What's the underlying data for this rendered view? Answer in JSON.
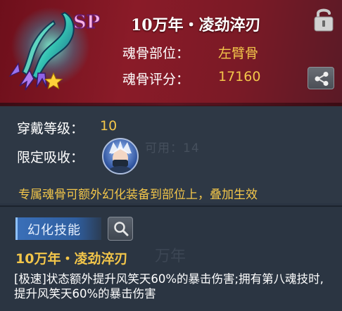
{
  "item": {
    "title": "10万年・凌劲淬刃",
    "slot_label": "魂骨部位：",
    "slot_value": "左臂骨",
    "score_label": "魂骨评分：",
    "score_value": "17160",
    "badge": "SP",
    "rarity_icon": "star-icon"
  },
  "details": {
    "level_label": "穿戴等级：",
    "level_value": "10",
    "absorb_label": "限定吸收：",
    "ghost_text": "可用：14",
    "notice": "专属魂骨可额外幻化装备到部位上，叠加生效"
  },
  "skill": {
    "tab_label": "幻化技能",
    "name": "10万年・凌劲淬刃",
    "ghost_text": "万年",
    "description": "[极速]状态额外提升风笑天60%的暴击伤害;拥有第八魂技时,提升风笑天60%的暴击伤害"
  },
  "colors": {
    "header_bg": "#7f1824",
    "body_bg": "#2e3845",
    "accent_gold": "#f3c64a",
    "tab_blue": "#3a6fb8"
  },
  "icons": {
    "lock": "lock-icon",
    "share": "share-icon",
    "search": "search-icon",
    "avatar": "character-avatar"
  }
}
